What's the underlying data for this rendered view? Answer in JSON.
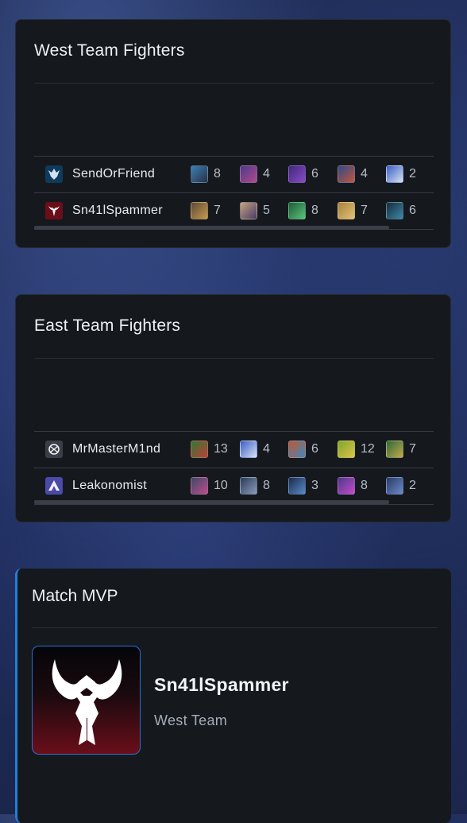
{
  "west": {
    "title": "West Team Fighters",
    "players": [
      {
        "name": "SendOrFriend",
        "avatar_color": "#0f3a5c",
        "heroes": [
          {
            "count": "8",
            "colors": [
              "#3a7fb8",
              "#2b3140"
            ]
          },
          {
            "count": "4",
            "colors": [
              "#4a3b8c",
              "#b24a8a"
            ]
          },
          {
            "count": "6",
            "colors": [
              "#3e2a7a",
              "#8a4ac8"
            ]
          },
          {
            "count": "4",
            "colors": [
              "#2b4a8a",
              "#c4563a"
            ]
          },
          {
            "count": "2",
            "colors": [
              "#3a5ec8",
              "#d8e2f0"
            ]
          }
        ]
      },
      {
        "name": "Sn41lSpammer",
        "avatar_color": "#6a0e1a",
        "heroes": [
          {
            "count": "7",
            "colors": [
              "#5a4a3a",
              "#c89a4a"
            ]
          },
          {
            "count": "5",
            "colors": [
              "#c4a47a",
              "#4a3a6a"
            ]
          },
          {
            "count": "8",
            "colors": [
              "#1f5a3a",
              "#5ac47a"
            ]
          },
          {
            "count": "7",
            "colors": [
              "#a8823a",
              "#e0c27a"
            ]
          },
          {
            "count": "6",
            "colors": [
              "#1a2a3a",
              "#3a8aa8"
            ]
          }
        ]
      }
    ]
  },
  "east": {
    "title": "East Team Fighters",
    "players": [
      {
        "name": "MrMasterM1nd",
        "avatar_color": "#3a3f47",
        "heroes": [
          {
            "count": "13",
            "colors": [
              "#2f7a2f",
              "#c43a3a"
            ]
          },
          {
            "count": "4",
            "colors": [
              "#3a5ec8",
              "#d8e2f0"
            ]
          },
          {
            "count": "6",
            "colors": [
              "#c4562a",
              "#3a8ac8"
            ]
          },
          {
            "count": "12",
            "colors": [
              "#7aa82a",
              "#e0c24a"
            ]
          },
          {
            "count": "7",
            "colors": [
              "#2a6a3a",
              "#c8a84a"
            ]
          }
        ]
      },
      {
        "name": "Leakonomist",
        "avatar_color": "#4a4aa8",
        "heroes": [
          {
            "count": "10",
            "colors": [
              "#3a4a6a",
              "#c44a8a"
            ]
          },
          {
            "count": "8",
            "colors": [
              "#2a3a5a",
              "#8a9ab8"
            ]
          },
          {
            "count": "3",
            "colors": [
              "#1a2a4a",
              "#5a8ac8"
            ]
          },
          {
            "count": "8",
            "colors": [
              "#4a3a8a",
              "#c84ac8"
            ]
          },
          {
            "count": "2",
            "colors": [
              "#2a3a6a",
              "#6a8ac8"
            ]
          }
        ]
      }
    ]
  },
  "mvp": {
    "title": "Match MVP",
    "name": "Sn41lSpammer",
    "team": "West Team",
    "accent": "#1f7fd6"
  }
}
